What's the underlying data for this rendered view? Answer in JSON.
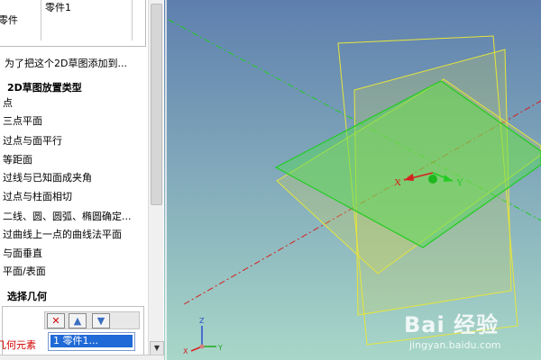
{
  "panel": {
    "owner_label": "零件",
    "owner_value": "零件1",
    "hint": "为了把这个2D草图添加到...",
    "placement_heading": "2D草图放置类型",
    "placement_options": [
      "点",
      "三点平面",
      "过点与面平行",
      "等距面",
      "过线与已知面成夹角",
      "过点与柱面相切",
      "二线、圆、圆弧、椭圆确定...",
      "过曲线上一点的曲线法平面",
      "与面垂直",
      "平面/表面"
    ],
    "selection_heading": "选择几何",
    "geometry_label": "几何元素",
    "selection_item": "1    零件1...",
    "delete_icon": "✕",
    "up_icon": "▲",
    "down_icon": "▼",
    "scroll_down_icon": "▼"
  },
  "viewport": {
    "x_axis_label": "X",
    "y_axis_label": "Y",
    "triad_z": "Z",
    "triad_y": "Y",
    "triad_x": "X",
    "colors": {
      "background_top": "#5e7fae",
      "background_bottom": "#a8d7c8",
      "green_plane": "#22cc22",
      "yellow_plane": "#e6e63a",
      "axis_red": "#d42020"
    }
  },
  "watermark": {
    "text": "Bai 经验",
    "domain": "jingyan.baidu.com"
  }
}
